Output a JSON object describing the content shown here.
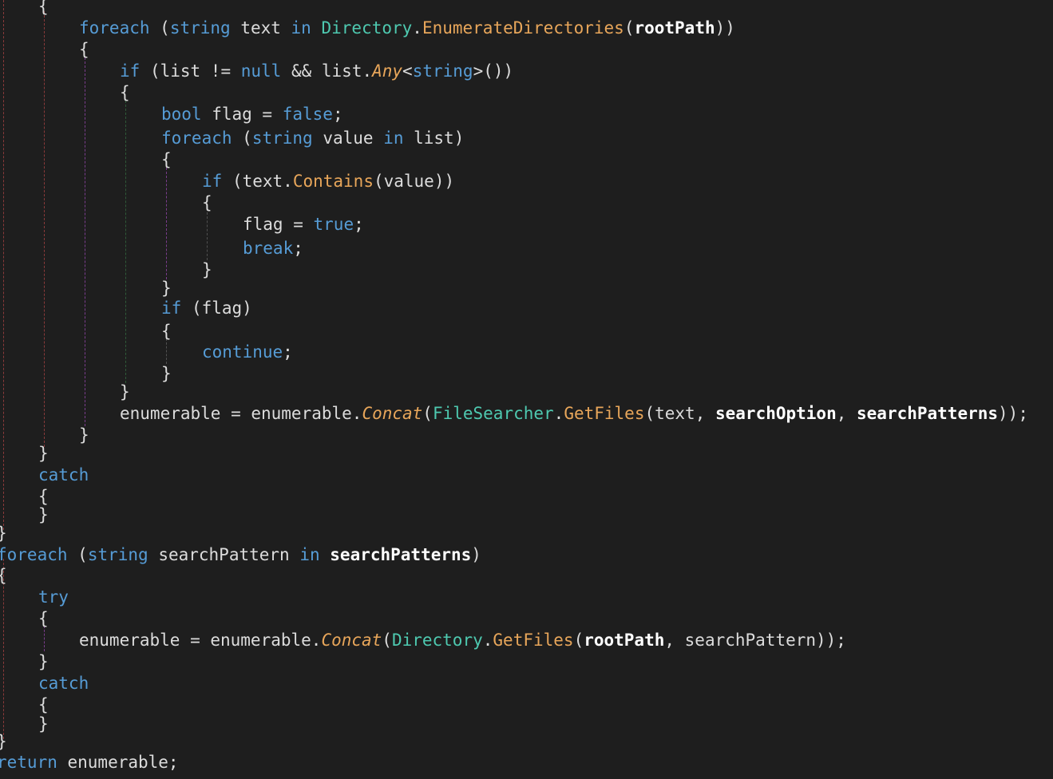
{
  "editor": {
    "theme": {
      "background": "#1e1e1e",
      "keyword": "#569cd6",
      "type": "#4ec9b0",
      "method": "#e8a65a",
      "parameter": "#ffffff",
      "text": "#dcdcdc"
    },
    "lines": [
      {
        "indent": 1,
        "tokens": [
          {
            "t": "{",
            "c": "punc"
          }
        ]
      },
      {
        "indent": 2,
        "tokens": [
          {
            "t": "foreach",
            "c": "kw"
          },
          {
            "t": " (",
            "c": "punc"
          },
          {
            "t": "string",
            "c": "kw"
          },
          {
            "t": " text ",
            "c": "plain"
          },
          {
            "t": "in",
            "c": "kw"
          },
          {
            "t": " ",
            "c": "plain"
          },
          {
            "t": "Directory",
            "c": "type"
          },
          {
            "t": ".",
            "c": "punc"
          },
          {
            "t": "EnumerateDirectories",
            "c": "method"
          },
          {
            "t": "(",
            "c": "punc"
          },
          {
            "t": "rootPath",
            "c": "param"
          },
          {
            "t": "))",
            "c": "punc"
          }
        ]
      },
      {
        "indent": 2,
        "tokens": [
          {
            "t": "{",
            "c": "punc"
          }
        ]
      },
      {
        "indent": 3,
        "tokens": [
          {
            "t": "if",
            "c": "kw"
          },
          {
            "t": " (list != ",
            "c": "plain"
          },
          {
            "t": "null",
            "c": "kw"
          },
          {
            "t": " && list.",
            "c": "plain"
          },
          {
            "t": "Any",
            "c": "ext"
          },
          {
            "t": "<",
            "c": "punc"
          },
          {
            "t": "string",
            "c": "kw"
          },
          {
            "t": ">())",
            "c": "punc"
          }
        ]
      },
      {
        "indent": 3,
        "tokens": [
          {
            "t": "{",
            "c": "punc"
          }
        ]
      },
      {
        "indent": 4,
        "tokens": [
          {
            "t": "bool",
            "c": "kw"
          },
          {
            "t": " flag = ",
            "c": "plain"
          },
          {
            "t": "false",
            "c": "kw"
          },
          {
            "t": ";",
            "c": "punc"
          }
        ]
      },
      {
        "indent": 4,
        "tokens": [
          {
            "t": "foreach",
            "c": "kw"
          },
          {
            "t": " (",
            "c": "punc"
          },
          {
            "t": "string",
            "c": "kw"
          },
          {
            "t": " value ",
            "c": "plain"
          },
          {
            "t": "in",
            "c": "kw"
          },
          {
            "t": " list)",
            "c": "plain"
          }
        ]
      },
      {
        "indent": 4,
        "tokens": [
          {
            "t": "{",
            "c": "punc"
          }
        ]
      },
      {
        "indent": 5,
        "tokens": [
          {
            "t": "if",
            "c": "kw"
          },
          {
            "t": " (text.",
            "c": "plain"
          },
          {
            "t": "Contains",
            "c": "method"
          },
          {
            "t": "(value))",
            "c": "plain"
          }
        ]
      },
      {
        "indent": 5,
        "tokens": [
          {
            "t": "{",
            "c": "punc"
          }
        ]
      },
      {
        "indent": 6,
        "tokens": [
          {
            "t": "flag = ",
            "c": "plain"
          },
          {
            "t": "true",
            "c": "kw"
          },
          {
            "t": ";",
            "c": "punc"
          }
        ]
      },
      {
        "indent": 6,
        "tokens": [
          {
            "t": "break",
            "c": "kw"
          },
          {
            "t": ";",
            "c": "punc"
          }
        ]
      },
      {
        "indent": 5,
        "tokens": [
          {
            "t": "}",
            "c": "punc"
          }
        ]
      },
      {
        "indent": 4,
        "tokens": [
          {
            "t": "}",
            "c": "punc"
          }
        ]
      },
      {
        "indent": 4,
        "tokens": [
          {
            "t": "if",
            "c": "kw"
          },
          {
            "t": " (flag)",
            "c": "plain"
          }
        ]
      },
      {
        "indent": 4,
        "tokens": [
          {
            "t": "{",
            "c": "punc"
          }
        ]
      },
      {
        "indent": 5,
        "tokens": [
          {
            "t": "continue",
            "c": "kw"
          },
          {
            "t": ";",
            "c": "punc"
          }
        ]
      },
      {
        "indent": 4,
        "tokens": [
          {
            "t": "}",
            "c": "punc"
          }
        ]
      },
      {
        "indent": 3,
        "tokens": [
          {
            "t": "}",
            "c": "punc"
          }
        ]
      },
      {
        "indent": 3,
        "tokens": [
          {
            "t": "enumerable = enumerable.",
            "c": "plain"
          },
          {
            "t": "Concat",
            "c": "ext"
          },
          {
            "t": "(",
            "c": "punc"
          },
          {
            "t": "FileSearcher",
            "c": "type"
          },
          {
            "t": ".",
            "c": "punc"
          },
          {
            "t": "GetFiles",
            "c": "method"
          },
          {
            "t": "(text, ",
            "c": "plain"
          },
          {
            "t": "searchOption",
            "c": "param"
          },
          {
            "t": ", ",
            "c": "plain"
          },
          {
            "t": "searchPatterns",
            "c": "param"
          },
          {
            "t": "));",
            "c": "punc"
          }
        ]
      },
      {
        "indent": 2,
        "tokens": [
          {
            "t": "}",
            "c": "punc"
          }
        ]
      },
      {
        "indent": 1,
        "tokens": [
          {
            "t": "}",
            "c": "punc"
          }
        ]
      },
      {
        "indent": 1,
        "tokens": [
          {
            "t": "catch",
            "c": "kw"
          }
        ]
      },
      {
        "indent": 1,
        "tokens": [
          {
            "t": "{",
            "c": "punc"
          }
        ]
      },
      {
        "indent": 1,
        "tokens": [
          {
            "t": "}",
            "c": "punc"
          }
        ]
      },
      {
        "indent": 0,
        "tokens": [
          {
            "t": "}",
            "c": "punc"
          }
        ]
      },
      {
        "indent": 0,
        "tokens": [
          {
            "t": "foreach",
            "c": "kw"
          },
          {
            "t": " (",
            "c": "punc"
          },
          {
            "t": "string",
            "c": "kw"
          },
          {
            "t": " searchPattern ",
            "c": "plain"
          },
          {
            "t": "in",
            "c": "kw"
          },
          {
            "t": " ",
            "c": "plain"
          },
          {
            "t": "searchPatterns",
            "c": "param"
          },
          {
            "t": ")",
            "c": "punc"
          }
        ]
      },
      {
        "indent": 0,
        "tokens": [
          {
            "t": "{",
            "c": "punc"
          }
        ]
      },
      {
        "indent": 1,
        "tokens": [
          {
            "t": "try",
            "c": "kw"
          }
        ]
      },
      {
        "indent": 1,
        "tokens": [
          {
            "t": "{",
            "c": "punc"
          }
        ]
      },
      {
        "indent": 2,
        "tokens": [
          {
            "t": "enumerable = enumerable.",
            "c": "plain"
          },
          {
            "t": "Concat",
            "c": "ext"
          },
          {
            "t": "(",
            "c": "punc"
          },
          {
            "t": "Directory",
            "c": "type"
          },
          {
            "t": ".",
            "c": "punc"
          },
          {
            "t": "GetFiles",
            "c": "method"
          },
          {
            "t": "(",
            "c": "punc"
          },
          {
            "t": "rootPath",
            "c": "param"
          },
          {
            "t": ", searchPattern));",
            "c": "plain"
          }
        ]
      },
      {
        "indent": 1,
        "tokens": [
          {
            "t": "}",
            "c": "punc"
          }
        ]
      },
      {
        "indent": 1,
        "tokens": [
          {
            "t": "catch",
            "c": "kw"
          }
        ]
      },
      {
        "indent": 1,
        "tokens": [
          {
            "t": "{",
            "c": "punc"
          }
        ]
      },
      {
        "indent": 1,
        "tokens": [
          {
            "t": "}",
            "c": "punc"
          }
        ]
      },
      {
        "indent": 0,
        "tokens": [
          {
            "t": "}",
            "c": "punc"
          }
        ]
      },
      {
        "indent": 0,
        "tokens": [
          {
            "t": "return",
            "c": "kw"
          },
          {
            "t": " enumerable;",
            "c": "plain"
          }
        ]
      }
    ]
  }
}
